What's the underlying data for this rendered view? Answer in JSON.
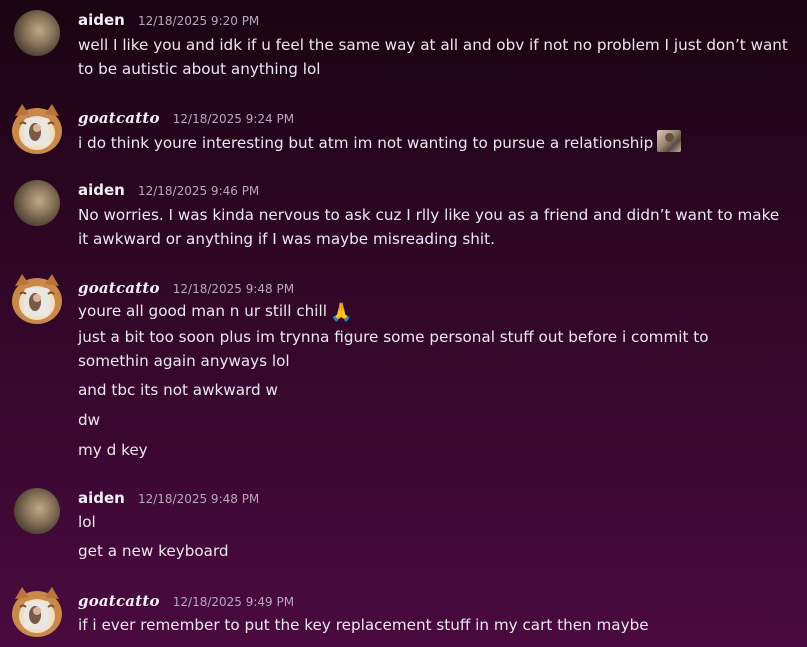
{
  "messages": [
    {
      "author": "aiden",
      "timestamp": "12/18/2025 9:20 PM",
      "lines": [
        "well I like you and idk if u feel the same way at all and obv if not no problem I just don’t want",
        "to be autistic about anything lol"
      ]
    },
    {
      "author": "goatcatto",
      "timestamp": "12/18/2025 9:24 PM",
      "lines": [
        "i do think youre interesting but atm im not wanting to pursue a relationship"
      ],
      "emoji": "photo-emoji"
    },
    {
      "author": "aiden",
      "timestamp": "12/18/2025 9:46 PM",
      "lines": [
        "No worries. I was kinda nervous to ask cuz I rlly like you as a friend and didn’t want to make",
        "it awkward or anything if I was maybe misreading shit."
      ]
    },
    {
      "author": "goatcatto",
      "timestamp": "12/18/2025 9:48 PM",
      "lines": [
        "youre all good man n ur still chill",
        "just a bit too soon plus im trynna figure some personal stuff out before i commit to",
        "somethin again anyways lol",
        "and tbc its not awkward w",
        "dw",
        "my d key"
      ],
      "emoji": "🙏"
    },
    {
      "author": "aiden",
      "timestamp": "12/18/2025 9:48 PM",
      "lines": [
        "lol",
        "get a new keyboard"
      ]
    },
    {
      "author": "goatcatto",
      "timestamp": "12/18/2025 9:49 PM",
      "lines": [
        "if i ever remember to put the key replacement stuff in my cart then maybe"
      ]
    }
  ],
  "colors": {
    "background_top": "#1b0412",
    "background_bottom": "#4a0a3f",
    "username": "#f4f1f6",
    "timestamp": "#b9a8bd",
    "text": "#ece8f0"
  }
}
